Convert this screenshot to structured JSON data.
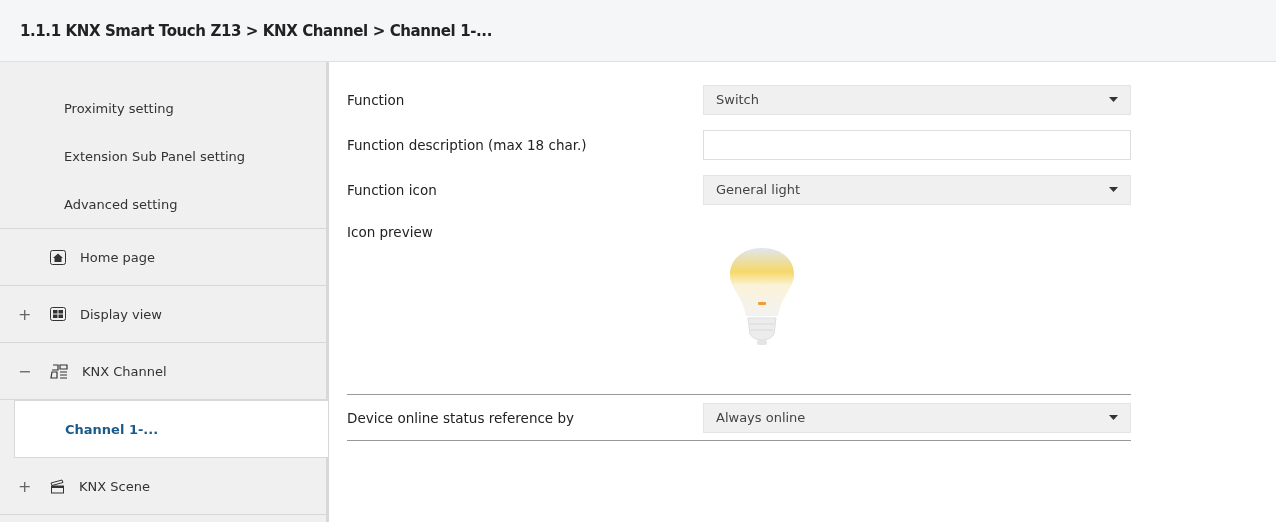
{
  "breadcrumb": "1.1.1 KNX Smart Touch Z13 > KNX Channel  > Channel 1-...",
  "sidebar": {
    "items": [
      {
        "kind": "sub",
        "label": "Proximity setting",
        "selected": false
      },
      {
        "kind": "sub",
        "label": "Extension Sub Panel setting",
        "selected": false
      },
      {
        "kind": "sub",
        "label": "Advanced setting",
        "selected": false
      },
      {
        "kind": "group",
        "label": "Home page",
        "selected": false
      },
      {
        "kind": "group",
        "expander": "+",
        "label": "Display view",
        "selected": false
      },
      {
        "kind": "group",
        "expander": "−",
        "label": "KNX Channel",
        "selected": false,
        "children": [
          {
            "label": "Channel 1-...",
            "selected": true
          }
        ]
      },
      {
        "kind": "group",
        "expander": "+",
        "label": "KNX Scene",
        "selected": false
      }
    ]
  },
  "params": [
    {
      "kind": "select",
      "label": "Function",
      "value": "Switch"
    },
    {
      "kind": "input",
      "label": "Function description (max 18 char.)"
    },
    {
      "kind": "select",
      "label": "Function icon",
      "value": "General light"
    },
    {
      "kind": "preview",
      "label": "Icon preview"
    },
    {
      "kind": "rule"
    },
    {
      "kind": "select",
      "label": "Device online status reference by",
      "value": "Always online"
    },
    {
      "kind": "rule"
    }
  ]
}
